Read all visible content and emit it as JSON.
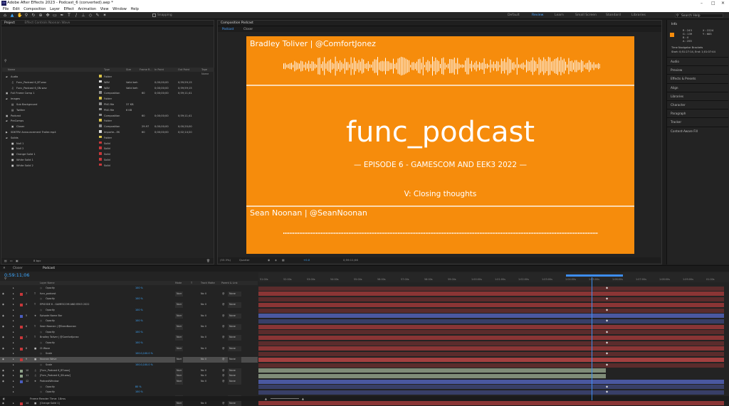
{
  "app": {
    "title": "Adobe After Effects 2023 - Podcast_6 (converted).aep *",
    "menu": [
      "File",
      "Edit",
      "Composition",
      "Layer",
      "Effect",
      "Animation",
      "View",
      "Window",
      "Help"
    ]
  },
  "toolbar": {
    "snapping": "Snapping",
    "workspaces": [
      "Default",
      "Review",
      "Learn",
      "Small Screen",
      "Standard",
      "Libraries"
    ],
    "search_placeholder": "Search Help"
  },
  "project_panel": {
    "tab": "Project",
    "effect_controls": "Effect Controls Noonan Wave",
    "columns": [
      "Name",
      "Type",
      "Size",
      "Frame R...",
      "In Point",
      "Out Point",
      "Tape Name"
    ],
    "items": [
      {
        "name": "Audio",
        "type": "Folder",
        "size": "",
        "fr": "",
        "in": "",
        "out": "",
        "color": "#d8c24a",
        "indent": 0,
        "icon": "folder"
      },
      {
        "name": "Func_Podcast 6_BT.wav",
        "type": "WAV",
        "size": "Valid beh",
        "fr": "",
        "in": "0;00;00;00",
        "out": "0;59;59;15",
        "color": "#dcdcdc",
        "indent": 1,
        "icon": "audio"
      },
      {
        "name": "Func_Podcast 6_SN.wav",
        "type": "WAV",
        "size": "Valid beh",
        "fr": "",
        "in": "0;00;00;00",
        "out": "0;59;59;15",
        "color": "#dcdcdc",
        "indent": 1,
        "icon": "audio"
      },
      {
        "name": "Full Frame Comp 1",
        "type": "Composition",
        "size": "",
        "fr": "60",
        "in": "0;00;00;00",
        "out": "0;59;11;41",
        "color": "#8f8f8f",
        "indent": 0,
        "icon": "comp"
      },
      {
        "name": "Images",
        "type": "Folder",
        "size": "",
        "fr": "",
        "in": "",
        "out": "",
        "color": "#d8c24a",
        "indent": 0,
        "icon": "folder"
      },
      {
        "name": "Sub Background",
        "type": "PNG file",
        "size": "37 KB",
        "fr": "",
        "in": "",
        "out": "",
        "color": "#8f8f8f",
        "indent": 1,
        "icon": "image"
      },
      {
        "name": "Twitter",
        "type": "PNG file",
        "size": "6 KB",
        "fr": "",
        "in": "",
        "out": "",
        "color": "#8f8f8f",
        "indent": 1,
        "icon": "image"
      },
      {
        "name": "Podcast",
        "type": "Composition",
        "size": "",
        "fr": "60",
        "in": "0;00;00;00",
        "out": "0;59;11;41",
        "color": "#8f8f8f",
        "indent": 0,
        "icon": "comp"
      },
      {
        "name": "PreComps",
        "type": "Folder",
        "size": "",
        "fr": "",
        "in": "",
        "out": "",
        "color": "#d8c24a",
        "indent": 0,
        "icon": "folder"
      },
      {
        "name": "Closer",
        "type": "Composition",
        "size": "",
        "fr": "29.97",
        "in": "0;00;00;00",
        "out": "0;00;20;00",
        "color": "#8f8f8f",
        "indent": 1,
        "icon": "comp"
      },
      {
        "name": "SDKTRV Announcement Trailer.mp4",
        "type": "Importe...EK",
        "size": "",
        "fr": "60",
        "in": "0;00;00;00",
        "out": "0;02;14;20",
        "color": "#dcdcdc",
        "indent": 0,
        "icon": "video"
      },
      {
        "name": "Solids",
        "type": "Folder",
        "size": "",
        "fr": "",
        "in": "",
        "out": "",
        "color": "#d8c24a",
        "indent": 0,
        "icon": "folder"
      },
      {
        "name": "Null 1",
        "type": "Solid",
        "size": "",
        "fr": "",
        "in": "",
        "out": "",
        "color": "#c8373a",
        "indent": 1,
        "icon": "solid"
      },
      {
        "name": "Null 2",
        "type": "Solid",
        "size": "",
        "fr": "",
        "in": "",
        "out": "",
        "color": "#c8373a",
        "indent": 1,
        "icon": "solid"
      },
      {
        "name": "Orange Solid 1",
        "type": "Solid",
        "size": "",
        "fr": "",
        "in": "",
        "out": "",
        "color": "#c8373a",
        "indent": 1,
        "icon": "solid"
      },
      {
        "name": "White Solid 1",
        "type": "Solid",
        "size": "",
        "fr": "",
        "in": "",
        "out": "",
        "color": "#c8373a",
        "indent": 1,
        "icon": "solid"
      },
      {
        "name": "White Solid 2",
        "type": "Solid",
        "size": "",
        "fr": "",
        "in": "",
        "out": "",
        "color": "#c8373a",
        "indent": 1,
        "icon": "solid"
      }
    ],
    "footer_bpc": "8 bpc"
  },
  "composition_panel": {
    "header": "Composition Podcast",
    "tabs": [
      "Podcast",
      "Closer"
    ],
    "canvas": {
      "top_speaker": "Bradley Toliver | @ComfortJonez",
      "title": "func_podcast",
      "episode": "— EPISODE 6 - GAMESCOM AND EEK3 2022 —",
      "section": "V: Closing thoughts",
      "bottom_speaker": "Sean Noonan | @SeanNoonan"
    },
    "footer": {
      "zoom": "(53.3%)",
      "resolution": "Quarter",
      "exposure": "+0.0",
      "time": "0;59:11;06"
    }
  },
  "right_panel": {
    "info_title": "Info",
    "info_values": [
      "R : 243",
      "G : 139",
      "B : 0",
      "A : 255"
    ],
    "coords": [
      "X : 2224",
      "Y : 683"
    ],
    "timecode_label": "Time Navigator Brackets",
    "timecode_info": "Start: 0;51:27:14, End: 1;01:07:44",
    "panels": [
      "Audio",
      "Preview",
      "Effects & Presets",
      "Align",
      "Libraries",
      "Character",
      "Paragraph",
      "Tracker",
      "Content-Aware Fill"
    ]
  },
  "timeline": {
    "tabs": [
      "Closer",
      "Podcast"
    ],
    "timecode": "0;59:11;06",
    "columns": [
      "Layer Name",
      "Mode",
      "T",
      "Track Matte",
      "Parent & Link"
    ],
    "ruler_labels": [
      "51:00s",
      "52:00s",
      "53:00s",
      "54:00s",
      "55:00s",
      "56:00s",
      "57:00s",
      "58:00s",
      "59:00s",
      "1:00:00s",
      "1:01:00s",
      "1:02:00s",
      "1:03:00s",
      "1:04:00s",
      "1:05:00s",
      "1:06:00s",
      "1:07:00s",
      "1:08:00s",
      "1:09:00s",
      "01:00s"
    ],
    "rows": [
      {
        "num": "",
        "name": "Opacity",
        "kind": "prop",
        "value": "100 %",
        "color": "",
        "bar": "#8a3535"
      },
      {
        "num": "7",
        "name": "func_podcast",
        "kind": "text",
        "value": "",
        "color": "#c8373a",
        "bar": "#8a3535"
      },
      {
        "num": "",
        "name": "Opacity",
        "kind": "prop",
        "value": "100 %",
        "color": "",
        "bar": "#8a3535"
      },
      {
        "num": "4",
        "name": "EPISODE 6 - GAMESCOM AND EEK3 2022",
        "kind": "text",
        "value": "",
        "color": "#c8373a",
        "bar": "#8a3535"
      },
      {
        "num": "",
        "name": "Opacity",
        "kind": "prop",
        "value": "100 %",
        "color": "",
        "bar": "#8a3535"
      },
      {
        "num": "5",
        "name": "Episode Name Bar",
        "kind": "shape",
        "value": "",
        "color": "#4a5dbf",
        "bar": "#4a58a0"
      },
      {
        "num": "",
        "name": "Opacity",
        "kind": "prop",
        "value": "100 %",
        "color": "",
        "bar": "#4a58a0"
      },
      {
        "num": "6",
        "name": "Sean Noonan | @SeanNoonan",
        "kind": "text",
        "value": "",
        "color": "#c8373a",
        "bar": "#8a3535"
      },
      {
        "num": "",
        "name": "Opacity",
        "kind": "prop",
        "value": "100 %",
        "color": "",
        "bar": "#8a3535"
      },
      {
        "num": "7",
        "name": "Bradley Toliver | @ComfortJonez",
        "kind": "text",
        "value": "",
        "color": "#c8373a",
        "bar": "#8a3535"
      },
      {
        "num": "",
        "name": "Opacity",
        "kind": "prop",
        "value": "100 %",
        "color": "",
        "bar": "#8a3535"
      },
      {
        "num": "8",
        "name": "Ct Wave",
        "kind": "solid",
        "value": "",
        "color": "#c8373a",
        "bar": "#8a3535"
      },
      {
        "num": "",
        "name": "Scale",
        "kind": "prop",
        "value": "100.0,100.0 %",
        "color": "",
        "bar": "#8a3535"
      },
      {
        "num": "9",
        "name": "Noonan Wave",
        "kind": "solid",
        "value": "",
        "color": "#c8373a",
        "bar": "#a44040",
        "selected": true
      },
      {
        "num": "",
        "name": "Scale",
        "kind": "prop",
        "value": "100.0,100.0 %",
        "color": "",
        "bar": "#8a3535"
      },
      {
        "num": "10",
        "name": "[Func_Podcast 6_BT.wav]",
        "kind": "audio",
        "value": "",
        "color": "#8fa38a",
        "bar": "#7f8c78"
      },
      {
        "num": "11",
        "name": "[Func_Podcast 6_SN.wav]",
        "kind": "audio",
        "value": "",
        "color": "#8fa38a",
        "bar": "#7f8c78"
      },
      {
        "num": "12",
        "name": "PodcastWindow",
        "kind": "shape",
        "value": "",
        "color": "#4a5dbf",
        "bar": "#4a58a0"
      },
      {
        "num": "",
        "name": "Opacity",
        "kind": "prop",
        "value": "80 %",
        "color": "",
        "bar": "#4a58a0"
      },
      {
        "num": "",
        "name": "Opacity",
        "kind": "prop",
        "value": "100 %",
        "color": "",
        "bar": "#4a58a0"
      },
      {
        "num": "13",
        "name": "[Full Frame Comp 1]",
        "kind": "comp",
        "value": "",
        "color": "#8fa38a",
        "bar": "#6b6b6b"
      },
      {
        "num": "14",
        "name": "[Orange Solid 1]",
        "kind": "solid",
        "value": "",
        "color": "#c8373a",
        "bar": "#8a3535"
      }
    ],
    "mode_label": "Norr",
    "matte_label": "No II",
    "parent_label": "None",
    "footer": "Frame Render Time: 18ms"
  },
  "colors": {
    "canvas": "#f68c0c",
    "accent": "#3da8ff"
  }
}
